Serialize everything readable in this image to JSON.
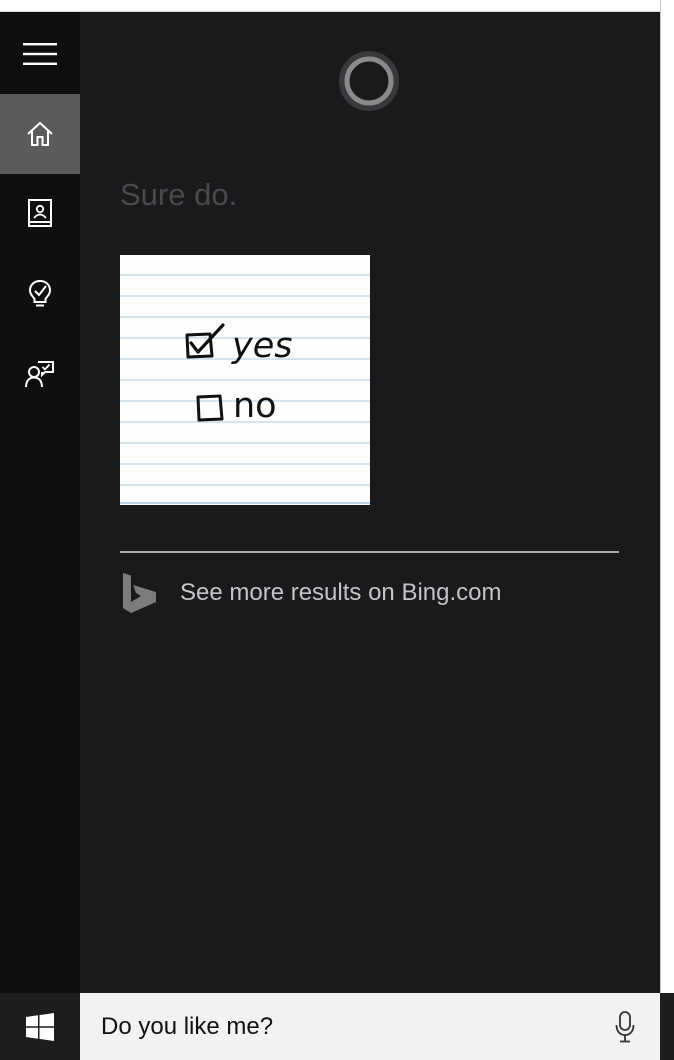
{
  "sidebar": {
    "items": [
      {
        "name": "menu",
        "icon": "hamburger-menu-icon"
      },
      {
        "name": "home",
        "icon": "home-icon",
        "active": true
      },
      {
        "name": "notebook",
        "icon": "notebook-icon"
      },
      {
        "name": "tips",
        "icon": "lightbulb-icon"
      },
      {
        "name": "feedback",
        "icon": "feedback-icon"
      }
    ]
  },
  "main": {
    "response": "Sure do.",
    "note_image": {
      "line1": "yes",
      "line2": "no",
      "line1_checked": true,
      "line2_checked": false
    },
    "bing_link": "See more results on Bing.com"
  },
  "taskbar": {
    "start_icon": "windows-logo-icon",
    "query": "Do you like me?",
    "mic_icon": "microphone-icon"
  },
  "colors": {
    "panel_bg": "#1b191c",
    "sidebar_bg": "#0f0e10",
    "active_item_bg": "#5b5a5c",
    "response_text": "#4a494c",
    "link_text": "#c4c3c6",
    "search_bg": "#f2f1f3"
  }
}
